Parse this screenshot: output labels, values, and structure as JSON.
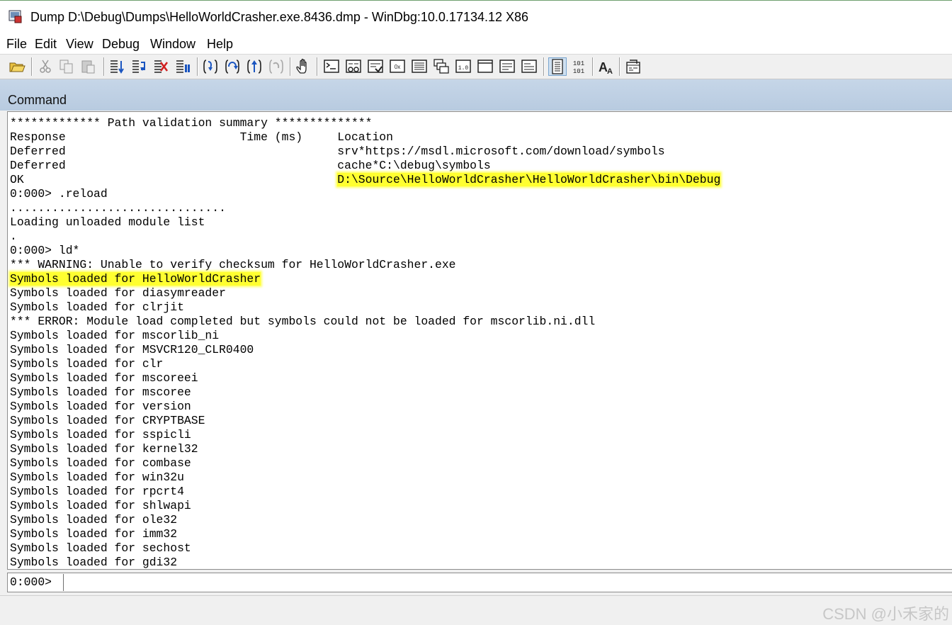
{
  "window": {
    "title": "Dump D:\\Debug\\Dumps\\HelloWorldCrasher.exe.8436.dmp - WinDbg:10.0.17134.12 X86",
    "app_icon": "windbg-app-icon"
  },
  "menu": [
    "File",
    "Edit",
    "View",
    "Debug",
    "Window",
    "Help"
  ],
  "toolbar": {
    "buttons": [
      {
        "name": "open-folder-icon",
        "enabled": true
      },
      {
        "name": "cut-icon",
        "enabled": false
      },
      {
        "name": "copy-icon",
        "enabled": false
      },
      {
        "name": "paste-icon",
        "enabled": false
      },
      {
        "name": "go-icon",
        "enabled": true
      },
      {
        "name": "restart-icon",
        "enabled": true
      },
      {
        "name": "stop-debugging-icon",
        "enabled": true
      },
      {
        "name": "break-icon",
        "enabled": true
      },
      {
        "name": "step-into-icon",
        "enabled": true
      },
      {
        "name": "step-over-icon",
        "enabled": true
      },
      {
        "name": "step-out-icon",
        "enabled": true
      },
      {
        "name": "run-to-cursor-icon",
        "enabled": false
      },
      {
        "name": "hand-icon",
        "enabled": true
      },
      {
        "name": "command-window-icon",
        "enabled": true
      },
      {
        "name": "watch-window-icon",
        "enabled": true
      },
      {
        "name": "locals-window-icon",
        "enabled": true
      },
      {
        "name": "registers-window-icon",
        "enabled": true
      },
      {
        "name": "memory-window-icon",
        "enabled": true
      },
      {
        "name": "call-stack-window-icon",
        "enabled": true
      },
      {
        "name": "disassembly-window-icon",
        "enabled": true
      },
      {
        "name": "scratch-pad-icon",
        "enabled": true
      },
      {
        "name": "processes-threads-icon",
        "enabled": true
      },
      {
        "name": "command-browser-icon",
        "enabled": true
      },
      {
        "name": "source-mode-icon",
        "enabled": true,
        "pressed": true
      },
      {
        "name": "hex-mode-icon",
        "enabled": true
      },
      {
        "name": "font-icon",
        "enabled": true
      },
      {
        "name": "options-icon",
        "enabled": true
      }
    ],
    "hex_glyph": "101\n101",
    "font_glyph": "A"
  },
  "command_window": {
    "title": "Command",
    "lines": [
      {
        "text": "************* Path validation summary **************",
        "highlight": ""
      },
      {
        "text": "Response                         Time (ms)     Location",
        "highlight": ""
      },
      {
        "text": "Deferred                                       srv*https://msdl.microsoft.com/download/symbols",
        "highlight": ""
      },
      {
        "text": "Deferred                                       cache*C:\\debug\\symbols",
        "highlight": ""
      },
      {
        "text": "OK                                             ",
        "highlight": "D:\\Source\\HelloWorldCrasher\\HelloWorldCrasher\\bin\\Debug"
      },
      {
        "text": "0:000> .reload",
        "highlight": ""
      },
      {
        "text": "...............................",
        "highlight": ""
      },
      {
        "text": "Loading unloaded module list",
        "highlight": ""
      },
      {
        "text": ".",
        "highlight": ""
      },
      {
        "text": "0:000> ld*",
        "highlight": ""
      },
      {
        "text": "*** WARNING: Unable to verify checksum for HelloWorldCrasher.exe",
        "highlight": ""
      },
      {
        "text": "",
        "highlight": "Symbols loaded for HelloWorldCrasher"
      },
      {
        "text": "Symbols loaded for diasymreader",
        "highlight": ""
      },
      {
        "text": "Symbols loaded for clrjit",
        "highlight": ""
      },
      {
        "text": "*** ERROR: Module load completed but symbols could not be loaded for mscorlib.ni.dll",
        "highlight": ""
      },
      {
        "text": "Symbols loaded for mscorlib_ni",
        "highlight": ""
      },
      {
        "text": "Symbols loaded for MSVCR120_CLR0400",
        "highlight": ""
      },
      {
        "text": "Symbols loaded for clr",
        "highlight": ""
      },
      {
        "text": "Symbols loaded for mscoreei",
        "highlight": ""
      },
      {
        "text": "Symbols loaded for mscoree",
        "highlight": ""
      },
      {
        "text": "Symbols loaded for version",
        "highlight": ""
      },
      {
        "text": "Symbols loaded for CRYPTBASE",
        "highlight": ""
      },
      {
        "text": "Symbols loaded for sspicli",
        "highlight": ""
      },
      {
        "text": "Symbols loaded for kernel32",
        "highlight": ""
      },
      {
        "text": "Symbols loaded for combase",
        "highlight": ""
      },
      {
        "text": "Symbols loaded for win32u",
        "highlight": ""
      },
      {
        "text": "Symbols loaded for rpcrt4",
        "highlight": ""
      },
      {
        "text": "Symbols loaded for shlwapi",
        "highlight": ""
      },
      {
        "text": "Symbols loaded for ole32",
        "highlight": ""
      },
      {
        "text": "Symbols loaded for imm32",
        "highlight": ""
      },
      {
        "text": "Symbols loaded for sechost",
        "highlight": ""
      },
      {
        "text": "Symbols loaded for gdi32",
        "highlight": ""
      }
    ],
    "prompt": "0:000>",
    "input_value": ""
  },
  "watermark": "CSDN @小禾家的",
  "colors": {
    "highlight": "#ffff30",
    "header": "#c2d3e6"
  }
}
